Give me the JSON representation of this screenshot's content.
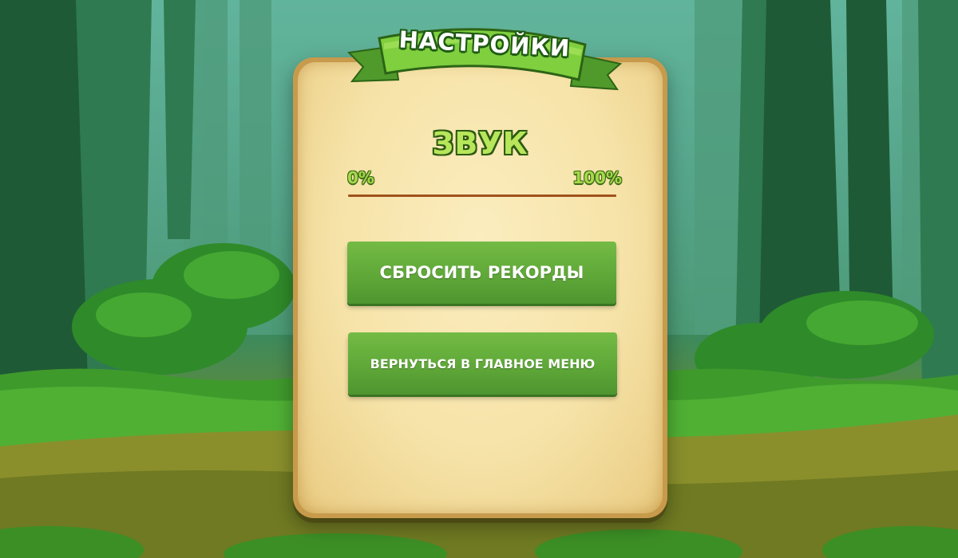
{
  "screen": {
    "ribbon_title": "НАСТРОЙКИ",
    "sound": {
      "title": "ЗВУК",
      "min_label": "0%",
      "max_label": "100%",
      "volume_fraction": 1.0
    },
    "buttons": {
      "reset_records": "СБРОСИТЬ РЕКОРДЫ",
      "back_to_menu": "ВЕРНУТЬСЯ В ГЛАВНОЕ МЕНЮ"
    }
  },
  "colors": {
    "button_green": "#5fa838",
    "title_green": "#b7e65a",
    "parchment": "#f6e3a8",
    "slider_brown": "#a0521c"
  }
}
